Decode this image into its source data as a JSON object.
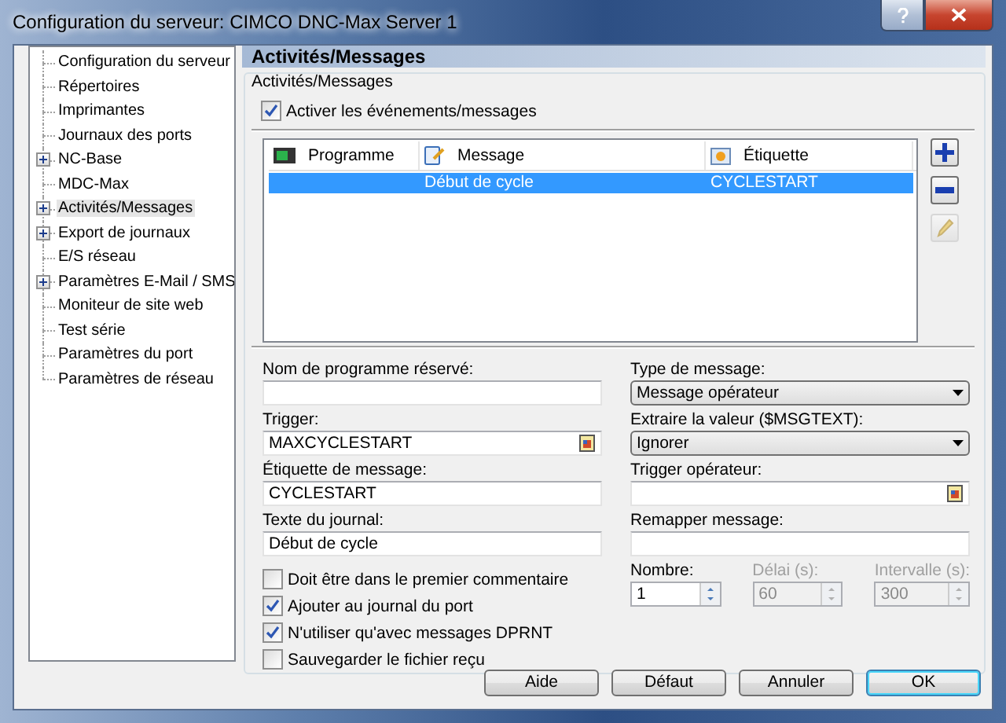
{
  "window": {
    "title": "Configuration du serveur: CIMCO DNC-Max Server 1"
  },
  "tree": [
    {
      "label": "Configuration du serveur",
      "expandable": false,
      "selected": false
    },
    {
      "label": "Répertoires",
      "expandable": false,
      "selected": false
    },
    {
      "label": "Imprimantes",
      "expandable": false,
      "selected": false
    },
    {
      "label": "Journaux des ports",
      "expandable": false,
      "selected": false
    },
    {
      "label": "NC-Base",
      "expandable": true,
      "selected": false
    },
    {
      "label": "MDC-Max",
      "expandable": false,
      "selected": false
    },
    {
      "label": "Activités/Messages",
      "expandable": true,
      "selected": true
    },
    {
      "label": "Export de journaux",
      "expandable": true,
      "selected": false
    },
    {
      "label": "E/S réseau",
      "expandable": false,
      "selected": false
    },
    {
      "label": "Paramètres E-Mail / SMS",
      "expandable": true,
      "selected": false
    },
    {
      "label": "Moniteur de site web",
      "expandable": false,
      "selected": false
    },
    {
      "label": "Test série",
      "expandable": false,
      "selected": false
    },
    {
      "label": "Paramètres du port",
      "expandable": false,
      "selected": false
    },
    {
      "label": "Paramètres de réseau",
      "expandable": false,
      "selected": false
    }
  ],
  "panel": {
    "title": "Activités/Messages",
    "group": "Activités/Messages",
    "enable": {
      "label": "Activer les événements/messages",
      "checked": true
    },
    "table": {
      "columns": [
        {
          "label": "Programme",
          "kind": "program"
        },
        {
          "label": "Message",
          "kind": "message"
        },
        {
          "label": "Étiquette",
          "kind": "tag"
        }
      ],
      "rows": [
        {
          "cells": [
            "",
            "Début de cycle",
            "CYCLESTART"
          ],
          "selected": true
        }
      ]
    },
    "side_buttons": [
      {
        "kind": "add",
        "disabled": false
      },
      {
        "kind": "remove",
        "disabled": false
      },
      {
        "kind": "edit",
        "disabled": true
      }
    ],
    "left_fields": [
      {
        "label": "Nom de programme réservé:",
        "kind": "text"
      },
      {
        "label": "Trigger:",
        "value": "MAXCYCLESTART",
        "kind": "browse"
      },
      {
        "label": "Étiquette de message:",
        "value": "CYCLESTART",
        "kind": "text"
      },
      {
        "label": "Texte du journal:",
        "value": "Début de cycle",
        "kind": "text"
      }
    ],
    "checkboxes": [
      {
        "label": "Doit être dans le premier commentaire",
        "checked": false
      },
      {
        "label": "Ajouter au journal du port",
        "checked": true
      },
      {
        "label": "N'utiliser qu'avec messages DPRNT",
        "checked": true
      },
      {
        "label": "Sauvegarder le fichier reçu",
        "checked": false
      }
    ],
    "right_fields": [
      {
        "label": "Type de message:",
        "value": "Message opérateur",
        "kind": "dropdown"
      },
      {
        "label": "Extraire la valeur ($MSGTEXT):",
        "value": "Ignorer",
        "kind": "dropdown"
      },
      {
        "label": "Trigger opérateur:",
        "kind": "browse"
      },
      {
        "label": "Remapper message:",
        "kind": "text"
      }
    ],
    "spinners": [
      {
        "label": "Nombre:",
        "value": "1",
        "disabled": false
      },
      {
        "label": "Délai (s):",
        "value": "60",
        "disabled": true
      },
      {
        "label": "Intervalle (s):",
        "value": "300",
        "disabled": true
      }
    ]
  },
  "buttons": [
    {
      "label": "Aide",
      "default": false
    },
    {
      "label": "Défaut",
      "default": false
    },
    {
      "label": "Annuler",
      "default": false
    },
    {
      "label": "OK",
      "default": true
    }
  ]
}
